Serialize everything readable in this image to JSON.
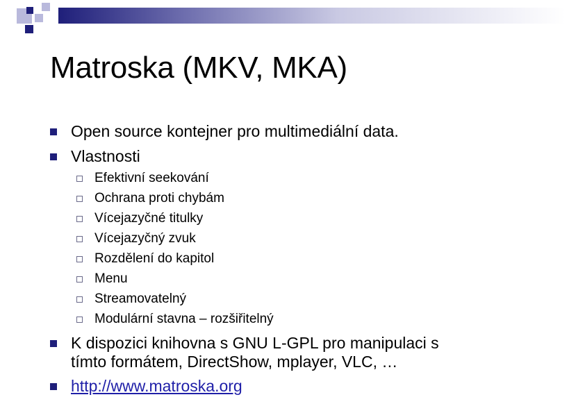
{
  "slide": {
    "title": "Matroska (MKV, MKA)",
    "bullets": {
      "b1": "Open source kontejner pro multimediální data.",
      "b2": "Vlastnosti",
      "b3_line1": "K dispozici knihovna s GNU L-GPL pro manipulaci s",
      "b3_line2": "tímto formátem, DirectShow, mplayer, VLC, …",
      "b4": "http://www.matroska.org"
    },
    "sub_bullets": [
      "Efektivní seekování",
      "Ochrana proti chybám",
      "Vícejazyčné titulky",
      "Vícejazyčný zvuk",
      "Rozdělení do kapitol",
      "Menu",
      "Streamovatelný",
      "Modulární stavna – rozšiřitelný"
    ]
  },
  "colors": {
    "accent": "#1f1f7a",
    "link": "#1f1fa8"
  }
}
